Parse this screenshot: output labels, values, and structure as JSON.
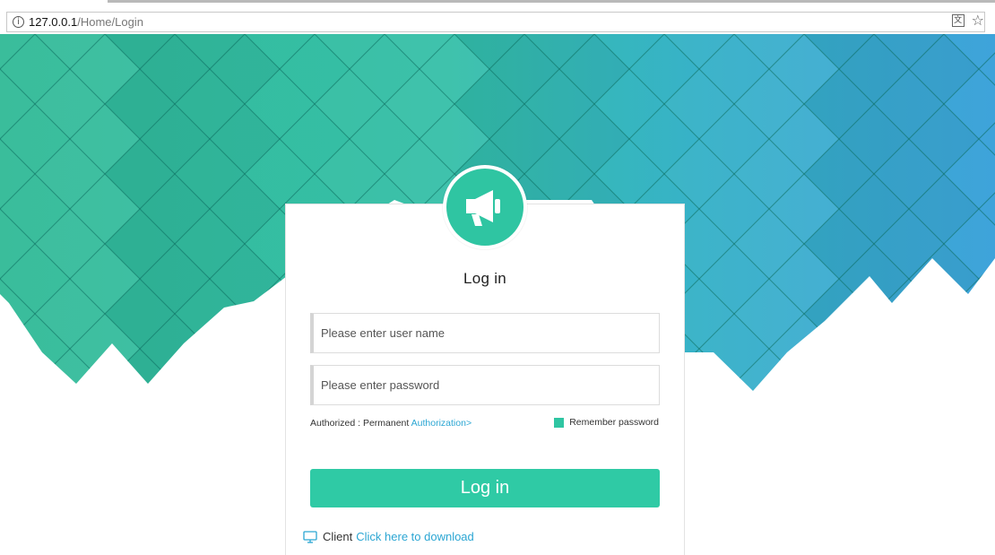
{
  "browser": {
    "url_host": "127.0.0.1",
    "url_path": "/Home/Login",
    "info_symbol": "i",
    "translate_symbol": "文",
    "bookmark_symbol": "☆"
  },
  "login": {
    "title": "Log in",
    "username_placeholder": "Please enter user name",
    "password_placeholder": "Please enter password",
    "authorized_text": "Authorized : Permanent",
    "authorization_link": "Authorization>",
    "remember_label": "Remember password",
    "remember_checked": true,
    "button_label": "Log in",
    "client_label": "Client",
    "download_link": "Click here to download"
  },
  "colors": {
    "accent": "#2fcaa5",
    "link": "#2ba6d3",
    "bg_teal": "#34bfa0",
    "bg_blue": "#3aa7d8"
  }
}
